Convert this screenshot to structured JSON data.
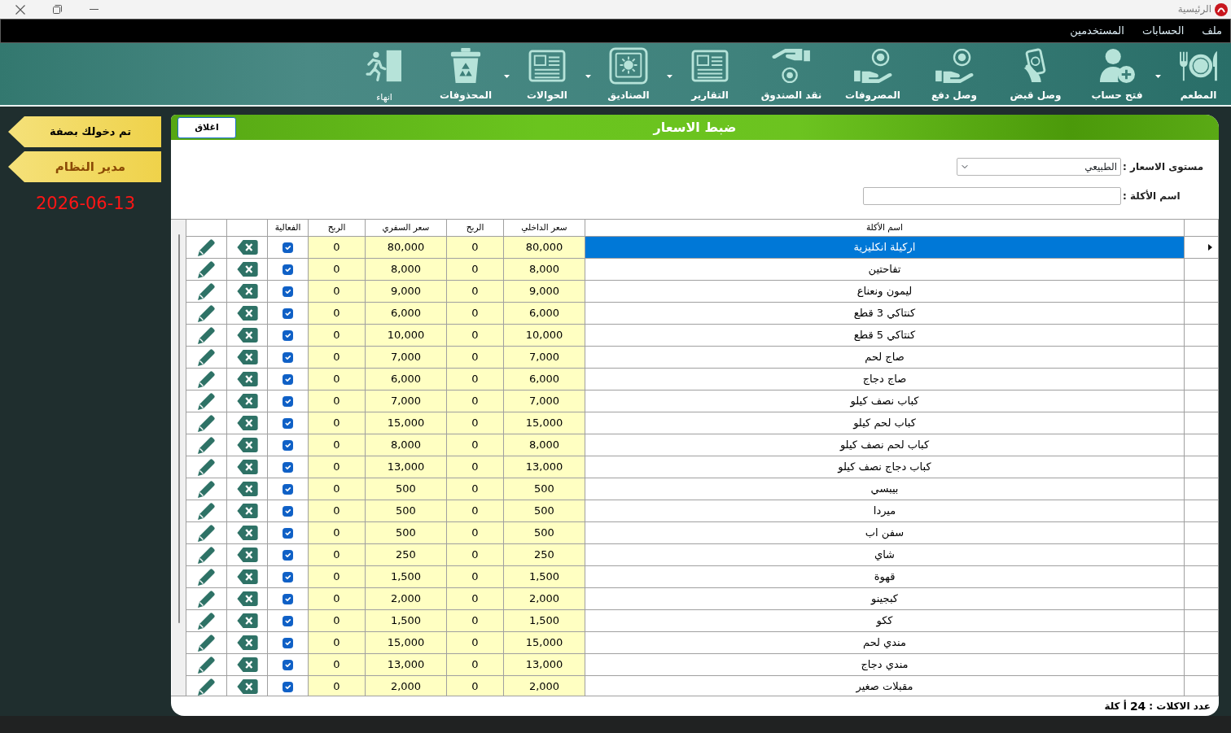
{
  "window": {
    "title": "الرئيسية"
  },
  "menu": [
    "ملف",
    "الحسابات",
    "المستخدمين"
  ],
  "toolbar": [
    {
      "label": "المطعم",
      "kind": "module",
      "dropdown": true
    },
    {
      "label": "فتح حساب",
      "kind": "module",
      "dropdown": false
    },
    {
      "label": "وصل قبض",
      "kind": "module",
      "dropdown": false
    },
    {
      "label": "وصل دفع",
      "kind": "module",
      "dropdown": false
    },
    {
      "label": "المصروفات",
      "kind": "module",
      "dropdown": false
    },
    {
      "label": "نقد الصندوق",
      "kind": "module",
      "dropdown": false
    },
    {
      "label": "التقارير",
      "kind": "module",
      "dropdown": true
    },
    {
      "label": "الصناديق",
      "kind": "module",
      "dropdown": true
    },
    {
      "label": "الحوالات",
      "kind": "module",
      "dropdown": true
    },
    {
      "label": "المحذوفات",
      "kind": "module",
      "dropdown": false
    },
    {
      "label": "انهاء",
      "kind": "exit",
      "dropdown": false
    }
  ],
  "sidebar": {
    "caption": "تم دخولك بصفة",
    "role": "مدير النظام",
    "date": "2026-06-13"
  },
  "panel": {
    "title": "ضبط الاسعار",
    "close_button": "اغلاق",
    "filters": [
      {
        "label": "مستوى الاسعار :",
        "kind": "select",
        "value": "الطبيعي"
      },
      {
        "label": "اسم الأكلة :",
        "kind": "text"
      }
    ],
    "table": {
      "columns": [
        "اسم الأكلة",
        "سعر الداخلي",
        "الربح",
        "سعر السفري",
        "الربح",
        "الفعالية"
      ],
      "rows": [
        {
          "name": "اركيلة انكليزية",
          "inner_price": "80,000",
          "inner_profit": "0",
          "takeaway_price": "80,000",
          "takeaway_profit": "0",
          "active": true,
          "selected": true
        },
        {
          "name": "تفاحتين",
          "inner_price": "8,000",
          "inner_profit": "0",
          "takeaway_price": "8,000",
          "takeaway_profit": "0",
          "active": true,
          "selected": false
        },
        {
          "name": "ليمون ونعناع",
          "inner_price": "9,000",
          "inner_profit": "0",
          "takeaway_price": "9,000",
          "takeaway_profit": "0",
          "active": true,
          "selected": false
        },
        {
          "name": "كنتاكي 3 قطع",
          "inner_price": "6,000",
          "inner_profit": "0",
          "takeaway_price": "6,000",
          "takeaway_profit": "0",
          "active": true,
          "selected": false
        },
        {
          "name": "كنتاكي 5 قطع",
          "inner_price": "10,000",
          "inner_profit": "0",
          "takeaway_price": "10,000",
          "takeaway_profit": "0",
          "active": true,
          "selected": false
        },
        {
          "name": "صاج لحم",
          "inner_price": "7,000",
          "inner_profit": "0",
          "takeaway_price": "7,000",
          "takeaway_profit": "0",
          "active": true,
          "selected": false
        },
        {
          "name": "صاج دجاج",
          "inner_price": "6,000",
          "inner_profit": "0",
          "takeaway_price": "6,000",
          "takeaway_profit": "0",
          "active": true,
          "selected": false
        },
        {
          "name": "كباب نصف كيلو",
          "inner_price": "7,000",
          "inner_profit": "0",
          "takeaway_price": "7,000",
          "takeaway_profit": "0",
          "active": true,
          "selected": false
        },
        {
          "name": "كباب لحم كيلو",
          "inner_price": "15,000",
          "inner_profit": "0",
          "takeaway_price": "15,000",
          "takeaway_profit": "0",
          "active": true,
          "selected": false
        },
        {
          "name": "كباب لحم نصف كيلو",
          "inner_price": "8,000",
          "inner_profit": "0",
          "takeaway_price": "8,000",
          "takeaway_profit": "0",
          "active": true,
          "selected": false
        },
        {
          "name": "كباب دجاج نصف كيلو",
          "inner_price": "13,000",
          "inner_profit": "0",
          "takeaway_price": "13,000",
          "takeaway_profit": "0",
          "active": true,
          "selected": false
        },
        {
          "name": "بيبسي",
          "inner_price": "500",
          "inner_profit": "0",
          "takeaway_price": "500",
          "takeaway_profit": "0",
          "active": true,
          "selected": false
        },
        {
          "name": "ميردا",
          "inner_price": "500",
          "inner_profit": "0",
          "takeaway_price": "500",
          "takeaway_profit": "0",
          "active": true,
          "selected": false
        },
        {
          "name": "سفن اب",
          "inner_price": "500",
          "inner_profit": "0",
          "takeaway_price": "500",
          "takeaway_profit": "0",
          "active": true,
          "selected": false
        },
        {
          "name": "شاي",
          "inner_price": "250",
          "inner_profit": "0",
          "takeaway_price": "250",
          "takeaway_profit": "0",
          "active": true,
          "selected": false
        },
        {
          "name": "قهوة",
          "inner_price": "1,500",
          "inner_profit": "0",
          "takeaway_price": "1,500",
          "takeaway_profit": "0",
          "active": true,
          "selected": false
        },
        {
          "name": "كبجينو",
          "inner_price": "2,000",
          "inner_profit": "0",
          "takeaway_price": "2,000",
          "takeaway_profit": "0",
          "active": true,
          "selected": false
        },
        {
          "name": "ككو",
          "inner_price": "1,500",
          "inner_profit": "0",
          "takeaway_price": "1,500",
          "takeaway_profit": "0",
          "active": true,
          "selected": false
        },
        {
          "name": "مندي لحم",
          "inner_price": "15,000",
          "inner_profit": "0",
          "takeaway_price": "15,000",
          "takeaway_profit": "0",
          "active": true,
          "selected": false
        },
        {
          "name": "مندي دجاج",
          "inner_price": "13,000",
          "inner_profit": "0",
          "takeaway_price": "13,000",
          "takeaway_profit": "0",
          "active": true,
          "selected": false
        },
        {
          "name": "مقبلات صغير",
          "inner_price": "2,000",
          "inner_profit": "0",
          "takeaway_price": "2,000",
          "takeaway_profit": "0",
          "active": true,
          "selected": false
        }
      ]
    },
    "footer": {
      "label": "عدد الاكلات :",
      "count": "24",
      "unit": "أ كلة"
    }
  }
}
